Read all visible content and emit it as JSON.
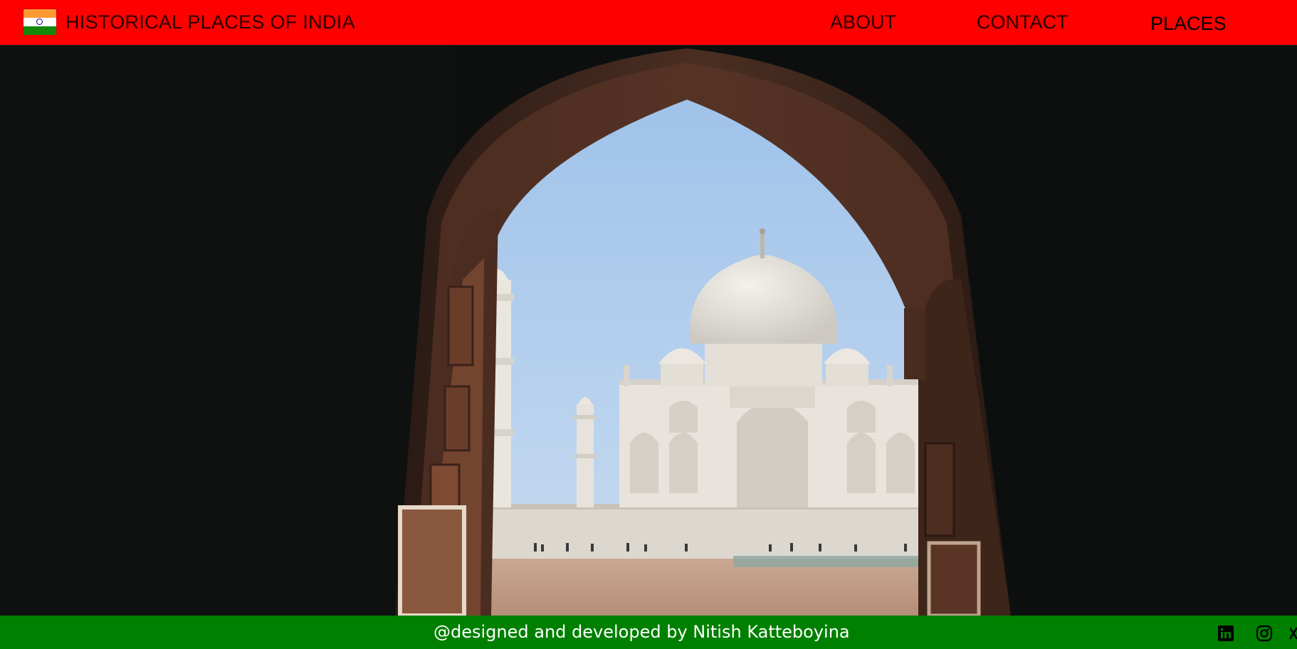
{
  "header": {
    "title": "HISTORICAL PLACES OF INDIA",
    "logo_icon": "india-flag-icon",
    "nav": {
      "about": "ABOUT",
      "contact": "CONTACT",
      "places": "PLACES"
    }
  },
  "hero": {
    "background_icon": "taj-mahal-through-arch-scene"
  },
  "footer": {
    "credit": "@designed and developed by Nitish Katteboyina",
    "social_icons": [
      "linkedin-icon",
      "instagram-icon",
      "x-icon"
    ]
  },
  "colors": {
    "header_bg": "#ff0000",
    "footer_bg": "#008000",
    "page_bg": "#0b0e0d",
    "sky": "#a7c8ec"
  }
}
